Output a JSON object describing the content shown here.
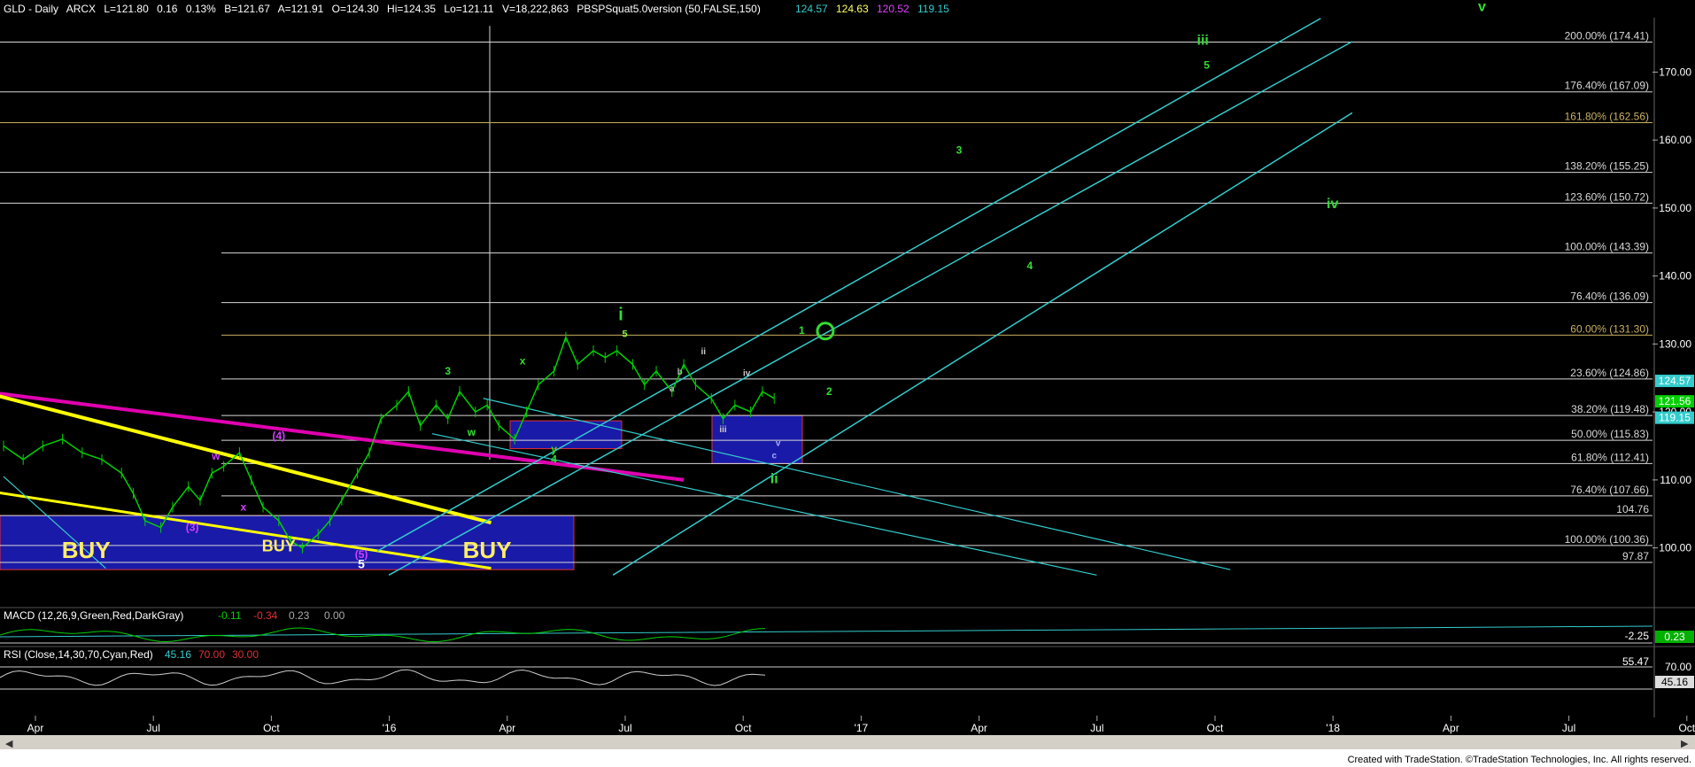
{
  "colors": {
    "background": "#000000",
    "candle": "#00d000",
    "fib_line": "#d8d8d8",
    "channel": "#33cccc",
    "trend_yellow": "#ffff00",
    "trend_magenta": "#e000b0",
    "box_blue": "#1a1aa8",
    "box_red": "#e03030",
    "wave_green": "#33dd33",
    "wave_light_green": "#88ee44",
    "wave_purple": "#d040ff",
    "text_yellow": "#ffee66",
    "scrollbar": "#d4d0c8"
  },
  "header": {
    "symbol": "GLD - Daily",
    "exchange": "ARCX",
    "last": "L=121.80",
    "change": "0.16",
    "change_pct": "0.13%",
    "bid": "B=121.67",
    "ask": "A=121.91",
    "open": "O=124.30",
    "high": "Hi=124.35",
    "low": "Lo=121.11",
    "volume": "V=18,222,863",
    "indicator": "PBSPSquat5.0version (50,FALSE,150)",
    "ind_values": [
      "124.57",
      "124.63",
      "120.52",
      "119.15"
    ],
    "ind_colors": [
      "#33cccc",
      "#ffff66",
      "#e040ff",
      "#33cccc"
    ]
  },
  "chart_data": {
    "type": "line",
    "title": "GLD - Daily",
    "ylabel": "",
    "ylim": [
      92,
      178
    ],
    "y_ticks": [
      100,
      110,
      120,
      130,
      140,
      150,
      160,
      170
    ],
    "y_tick_labels": [
      "100.00",
      "110.00",
      "120.00",
      "130.00",
      "140.00",
      "150.00",
      "160.00",
      "170.00"
    ],
    "x_months": [
      {
        "i": 0,
        "label": "Apr"
      },
      {
        "i": 3,
        "label": "Jul"
      },
      {
        "i": 6,
        "label": "Oct"
      },
      {
        "i": 9,
        "label": "'16"
      },
      {
        "i": 12,
        "label": "Apr"
      },
      {
        "i": 15,
        "label": "Jul"
      },
      {
        "i": 18,
        "label": "Oct"
      },
      {
        "i": 21,
        "label": "'17"
      },
      {
        "i": 24,
        "label": "Apr"
      },
      {
        "i": 27,
        "label": "Jul"
      },
      {
        "i": 30,
        "label": "Oct"
      },
      {
        "i": 33,
        "label": "'18"
      },
      {
        "i": 36,
        "label": "Apr"
      },
      {
        "i": 39,
        "label": "Jul"
      },
      {
        "i": 42,
        "label": "Oct"
      }
    ],
    "price_series": {
      "name": "GLD",
      "x": [
        0,
        0.5,
        1,
        1.5,
        2,
        2.5,
        3,
        3.3,
        3.6,
        4,
        4.3,
        4.7,
        5,
        5.3,
        5.6,
        6,
        6.3,
        6.6,
        7,
        7.3,
        7.6,
        8,
        8.3,
        8.6,
        9,
        9.3,
        9.6,
        10,
        10.3,
        10.6,
        11,
        11.3,
        11.6,
        12,
        12.3,
        12.6,
        13,
        13.3,
        13.6,
        14,
        14.3,
        14.6,
        15,
        15.3,
        15.6,
        16,
        16.3,
        16.6,
        17,
        17.3,
        17.6,
        18,
        18.3,
        18.6,
        19,
        19.3,
        19.6
      ],
      "y": [
        115,
        113,
        115,
        116,
        114,
        113,
        111,
        108,
        104,
        103,
        106,
        109,
        107,
        111,
        112,
        114,
        110,
        106,
        104,
        101,
        100,
        102,
        104,
        107,
        111,
        114,
        119,
        121,
        123,
        118,
        121,
        119,
        123,
        120,
        121,
        118,
        116,
        120,
        124,
        126,
        131,
        127,
        129,
        128,
        129,
        127,
        124,
        126,
        123,
        127,
        124,
        122,
        119,
        121,
        120,
        123,
        122
      ]
    },
    "fib_levels": [
      {
        "label": "200.00% (174.41)",
        "y": 174.41
      },
      {
        "label": "176.40% (167.09)",
        "y": 167.09
      },
      {
        "label": "161.80% (162.56)",
        "y": 162.56
      },
      {
        "label": "138.20% (155.25)",
        "y": 155.25
      },
      {
        "label": "123.60% (150.72)",
        "y": 150.72
      },
      {
        "label": "100.00% (143.39)",
        "y": 143.39
      },
      {
        "label": "76.40% (136.09)",
        "y": 136.09
      },
      {
        "label": "60.00% (131.30)",
        "y": 131.3
      },
      {
        "label": "23.60% (124.86)",
        "y": 124.86
      },
      {
        "label": "38.20% (119.48)",
        "y": 119.48
      },
      {
        "label": "50.00% (115.83)",
        "y": 115.83
      },
      {
        "label": "61.80% (112.41)",
        "y": 112.41
      },
      {
        "label": "76.40% (107.66)",
        "y": 107.66
      },
      {
        "label": "104.76",
        "y": 104.76
      },
      {
        "label": "100.00% (100.36)",
        "y": 100.36
      },
      {
        "label": "97.87",
        "y": 97.87
      }
    ],
    "price_markers": [
      {
        "label": "124.57",
        "y": 124.57,
        "color": "#33cccc"
      },
      {
        "label": "121.56",
        "y": 121.56,
        "color": "#00d000"
      },
      {
        "label": "119.15",
        "y": 119.15,
        "color": "#33cccc"
      }
    ],
    "wave_labels": [
      {
        "text": "i",
        "x": 15.7,
        "y": 133.5,
        "color": "#33dd33",
        "size": 20
      },
      {
        "text": "5",
        "x": 15.8,
        "y": 131,
        "color": "#88ee44",
        "size": 11
      },
      {
        "text": "3",
        "x": 11.3,
        "y": 125.5,
        "color": "#33dd33",
        "size": 12
      },
      {
        "text": "x",
        "x": 13.2,
        "y": 127,
        "color": "#33dd33",
        "size": 12
      },
      {
        "text": "w",
        "x": 11.9,
        "y": 116.5,
        "color": "#33dd33",
        "size": 12
      },
      {
        "text": "y",
        "x": 14.0,
        "y": 114,
        "color": "#33dd33",
        "size": 12
      },
      {
        "text": "4",
        "x": 14.0,
        "y": 112.5,
        "color": "#33dd33",
        "size": 12
      },
      {
        "text": "ii",
        "x": 19.6,
        "y": 109.5,
        "color": "#33dd33",
        "size": 16
      },
      {
        "text": "1",
        "x": 20.3,
        "y": 131.5,
        "color": "#33dd33",
        "size": 12
      },
      {
        "text": "2",
        "x": 21.0,
        "y": 122.5,
        "color": "#33dd33",
        "size": 12
      },
      {
        "text": "3",
        "x": 24.3,
        "y": 158,
        "color": "#33dd33",
        "size": 12
      },
      {
        "text": "4",
        "x": 26.1,
        "y": 141,
        "color": "#33dd33",
        "size": 12
      },
      {
        "text": "iii",
        "x": 30.5,
        "y": 174,
        "color": "#33dd33",
        "size": 16
      },
      {
        "text": "5",
        "x": 30.6,
        "y": 170.5,
        "color": "#33dd33",
        "size": 12
      },
      {
        "text": "iv",
        "x": 33.8,
        "y": 150,
        "color": "#33dd33",
        "size": 16
      },
      {
        "text": "v",
        "x": 37.6,
        "y": 179,
        "color": "#33dd33",
        "size": 16
      },
      {
        "text": "ii",
        "x": 17.8,
        "y": 128.5,
        "color": "#cccccc",
        "size": 10
      },
      {
        "text": "iii",
        "x": 18.3,
        "y": 117,
        "color": "#cccccc",
        "size": 10
      },
      {
        "text": "iv",
        "x": 18.9,
        "y": 125.3,
        "color": "#cccccc",
        "size": 10
      },
      {
        "text": "v",
        "x": 19.7,
        "y": 115,
        "color": "#aaaaff",
        "size": 10
      },
      {
        "text": "c",
        "x": 19.6,
        "y": 113.2,
        "color": "#aaaaff",
        "size": 10
      },
      {
        "text": "a",
        "x": 17.0,
        "y": 123,
        "color": "#aaaaaa",
        "size": 10
      },
      {
        "text": "b",
        "x": 17.2,
        "y": 125.5,
        "color": "#aaaaaa",
        "size": 10
      },
      {
        "text": "(4)",
        "x": 7.0,
        "y": 116,
        "color": "#d040ff",
        "size": 12
      },
      {
        "text": "w",
        "x": 5.4,
        "y": 113,
        "color": "#d040ff",
        "size": 12
      },
      {
        "text": "x",
        "x": 6.1,
        "y": 105.5,
        "color": "#d040ff",
        "size": 12
      },
      {
        "text": "(3)",
        "x": 4.8,
        "y": 102.5,
        "color": "#d040ff",
        "size": 12
      },
      {
        "text": "(5)",
        "x": 9.1,
        "y": 98.5,
        "color": "#d040ff",
        "size": 12
      },
      {
        "text": "5",
        "x": 9.1,
        "y": 97.0,
        "color": "#ffffff",
        "size": 14
      },
      {
        "text": "BUY",
        "x": 2.1,
        "y": 98.5,
        "color": "#ffee66",
        "size": 26
      },
      {
        "text": "BUY",
        "x": 7.0,
        "y": 99.5,
        "color": "#ffee66",
        "size": 18
      },
      {
        "text": "BUY",
        "x": 12.3,
        "y": 98.5,
        "color": "#ffee66",
        "size": 26
      }
    ],
    "macd": {
      "label": "MACD (12,26,9,Green,Red,DarkGray)",
      "values": [
        "-0.11",
        "-0.34",
        "0.23",
        "0.00"
      ],
      "value_colors": [
        "#00d000",
        "#e03030",
        "#aaaaaa",
        "#aaaaaa"
      ],
      "right_labels": [
        "0.23",
        "-2.25"
      ]
    },
    "rsi": {
      "label": "RSI (Close,14,30,70,Cyan,Red)",
      "values": [
        "45.16",
        "70.00",
        "30.00"
      ],
      "value_colors": [
        "#33cccc",
        "#e03030",
        "#e03030"
      ],
      "right_labels": [
        "70.00",
        "55.47",
        "45.16"
      ]
    }
  },
  "footer": {
    "credit": "Created with TradeStation. ©TradeStation Technologies, Inc. All rights reserved."
  }
}
